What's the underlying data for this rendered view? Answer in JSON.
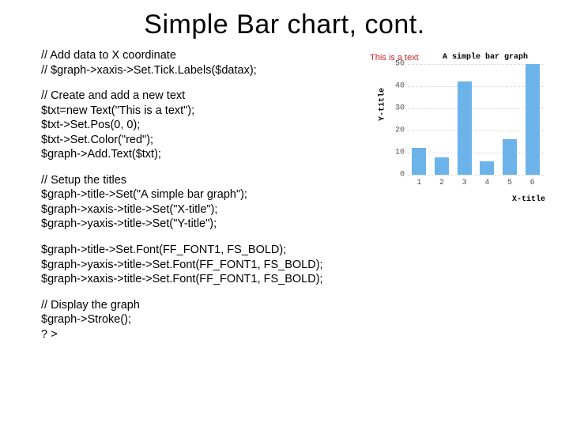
{
  "slide": {
    "title": "Simple Bar chart, cont."
  },
  "code": {
    "block1": [
      "// Add data to X coordinate",
      "// $graph->xaxis->Set.Tick.Labels($datax);"
    ],
    "block2": [
      "// Create and add a new text",
      "$txt=new Text(\"This is a text\");",
      "$txt->Set.Pos(0, 0);",
      "$txt->Set.Color(\"red\");",
      "$graph->Add.Text($txt);"
    ],
    "block3": [
      "// Setup the titles",
      "$graph->title->Set(\"A simple bar graph\");",
      "$graph->xaxis->title->Set(\"X-title\");",
      "$graph->yaxis->title->Set(\"Y-title\");"
    ],
    "block4": [
      "$graph->title->Set.Font(FF_FONT1, FS_BOLD);",
      "$graph->yaxis->title->Set.Font(FF_FONT1, FS_BOLD);",
      "$graph->xaxis->title->Set.Font(FF_FONT1, FS_BOLD);"
    ],
    "block5": [
      "// Display the graph",
      "$graph->Stroke();",
      "? >"
    ]
  },
  "chart_data": {
    "type": "bar",
    "title": "A simple bar graph",
    "annotation": "This is a text",
    "xlabel": "X-title",
    "ylabel": "Y-title",
    "ylim": [
      0,
      50
    ],
    "yticks": [
      0,
      10,
      20,
      30,
      40,
      50
    ],
    "categories": [
      "1",
      "2",
      "3",
      "4",
      "5",
      "6"
    ],
    "values": [
      12,
      8,
      42,
      6,
      16,
      50
    ],
    "bar_color": "#6cb3ea"
  }
}
